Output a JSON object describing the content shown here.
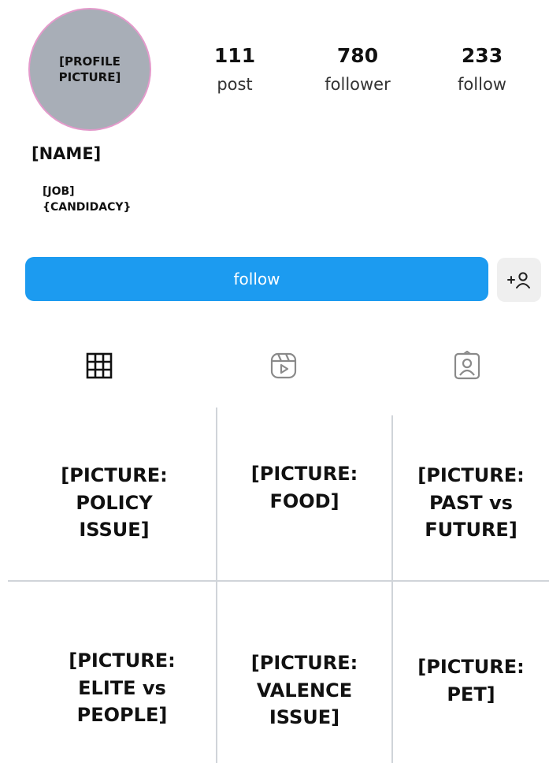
{
  "profile": {
    "avatar_label": "[PROFILE\nPICTURE]",
    "name": "[NAME]",
    "bio": "[JOB]\n{CANDIDACY}"
  },
  "stats": [
    {
      "value": "111",
      "label": "post"
    },
    {
      "value": "780",
      "label": "follower"
    },
    {
      "value": "233",
      "label": "follow"
    }
  ],
  "actions": {
    "follow_label": "follow",
    "add_friend_icon": "add-person-icon"
  },
  "tabs": [
    {
      "icon": "grid-icon",
      "active": true
    },
    {
      "icon": "reels-icon",
      "active": false
    },
    {
      "icon": "tagged-icon",
      "active": false
    }
  ],
  "posts": [
    "[PICTURE:\nPOLICY\nISSUE]",
    "[PICTURE:\nFOOD]",
    "[PICTURE:\nPAST vs\nFUTURE]",
    "[PICTURE:\nELITE vs\nPEOPLE]",
    "[PICTURE:\nVALENCE\nISSUE]",
    "[PICTURE:\nPET]"
  ],
  "colors": {
    "follow_button": "#1c9bf0",
    "avatar_fill": "#a8aeb7",
    "avatar_ring": "#e39acb"
  }
}
